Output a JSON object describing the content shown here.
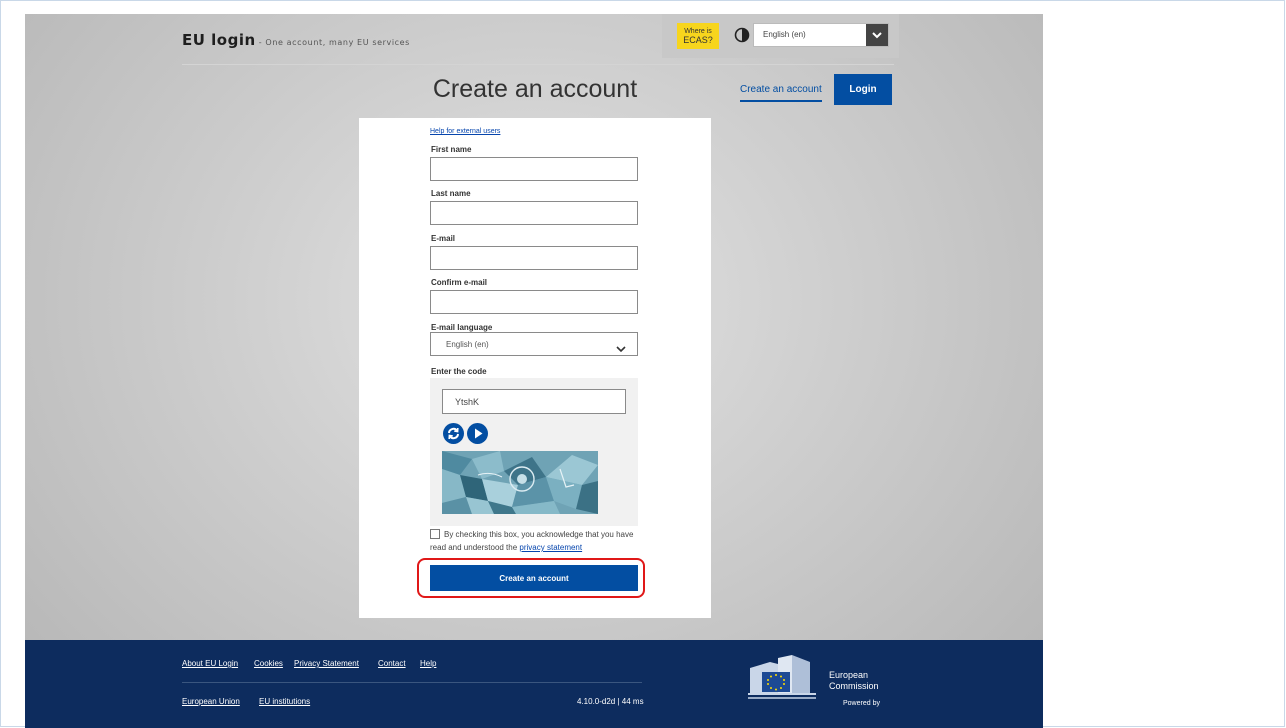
{
  "header": {
    "brand_title": "EU login",
    "brand_tagline": " - One account, many EU services",
    "ecas_line1": "Where is",
    "ecas_line2": "ECAS?",
    "contrast_icon": "contrast-icon",
    "language_selected": "English (en)"
  },
  "page": {
    "title": "Create an account",
    "tab_create": "Create an account",
    "tab_login": "Login"
  },
  "form": {
    "help_link": "Help for external users",
    "first_name_label": "First name",
    "first_name_value": "",
    "last_name_label": "Last name",
    "last_name_value": "",
    "email_label": "E-mail",
    "email_value": "",
    "confirm_email_label": "Confirm e-mail",
    "confirm_email_value": "",
    "email_language_label": "E-mail language",
    "email_language_selected": "English (en)",
    "code_label": "Enter the code",
    "code_value": "YtshK",
    "refresh_icon": "refresh-icon",
    "play_icon": "play-audio-icon",
    "consent_text": "By checking this box, you acknowledge that you have read and understood the ",
    "consent_link": "privacy statement",
    "consent_checked": false,
    "submit_label": "Create an account"
  },
  "footer": {
    "links": [
      "About EU Login",
      "Cookies",
      "Privacy Statement",
      "Contact",
      "Help"
    ],
    "links2": [
      "European Union",
      "EU institutions"
    ],
    "version": "4.10.0-d2d | 44 ms",
    "logo_line1": "European",
    "logo_line2": "Commission",
    "powered_by": "Powered by"
  },
  "colors": {
    "primary": "#034ea2",
    "footer_bg": "#0d2c5e",
    "ecas_yellow": "#f7d51d",
    "highlight_ring": "#e01818"
  }
}
